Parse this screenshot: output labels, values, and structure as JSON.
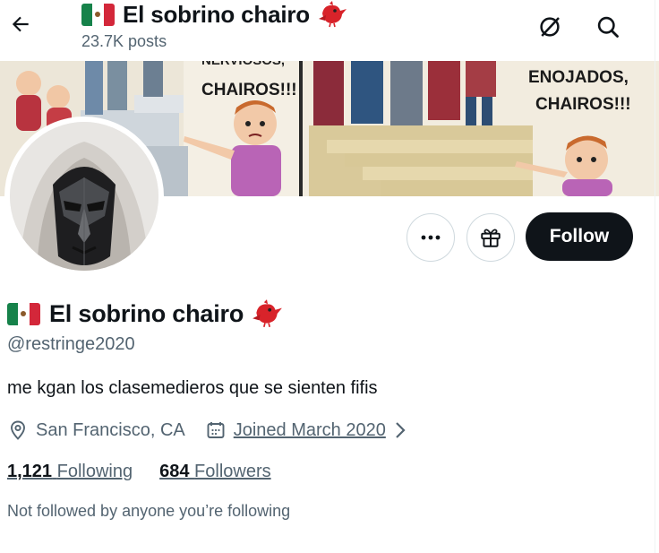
{
  "header": {
    "name": "El sobrino chairo",
    "posts": "23.7K posts"
  },
  "banner": {
    "text_left_partial": "NERVIOSOS,",
    "text_left": "CHAIROS!!!",
    "text_right_line1": "ENOJADOS,",
    "text_right_line2": "CHAIROS!!!"
  },
  "profile": {
    "name": "El sobrino chairo",
    "handle": "@restringe2020",
    "bio": "me kgan los clasemedieros que se sienten fifis",
    "location": "San Francisco, CA",
    "joined": "Joined March 2020",
    "following_count": "1,121",
    "following_label": "Following",
    "followers_count": "684",
    "followers_label": "Followers",
    "not_followed_text": "Not followed by anyone you’re following"
  },
  "actions": {
    "follow_label": "Follow"
  },
  "icons": {
    "back": "arrow-left-icon",
    "hide_replies": "circle-slash-icon",
    "search": "search-icon",
    "more": "more-dots-icon",
    "gift": "gift-icon",
    "location": "location-pin-icon",
    "calendar": "calendar-icon",
    "chevron": "chevron-right-icon",
    "flag": "mexico-flag-icon",
    "bird": "red-bird-icon"
  },
  "colors": {
    "text_primary": "#0f1419",
    "text_secondary": "#536471",
    "follow_bg": "#0f1419",
    "border": "#cfd9de",
    "flag_green": "#16824a",
    "flag_red": "#d3273a",
    "bird_red": "#d8232a"
  }
}
